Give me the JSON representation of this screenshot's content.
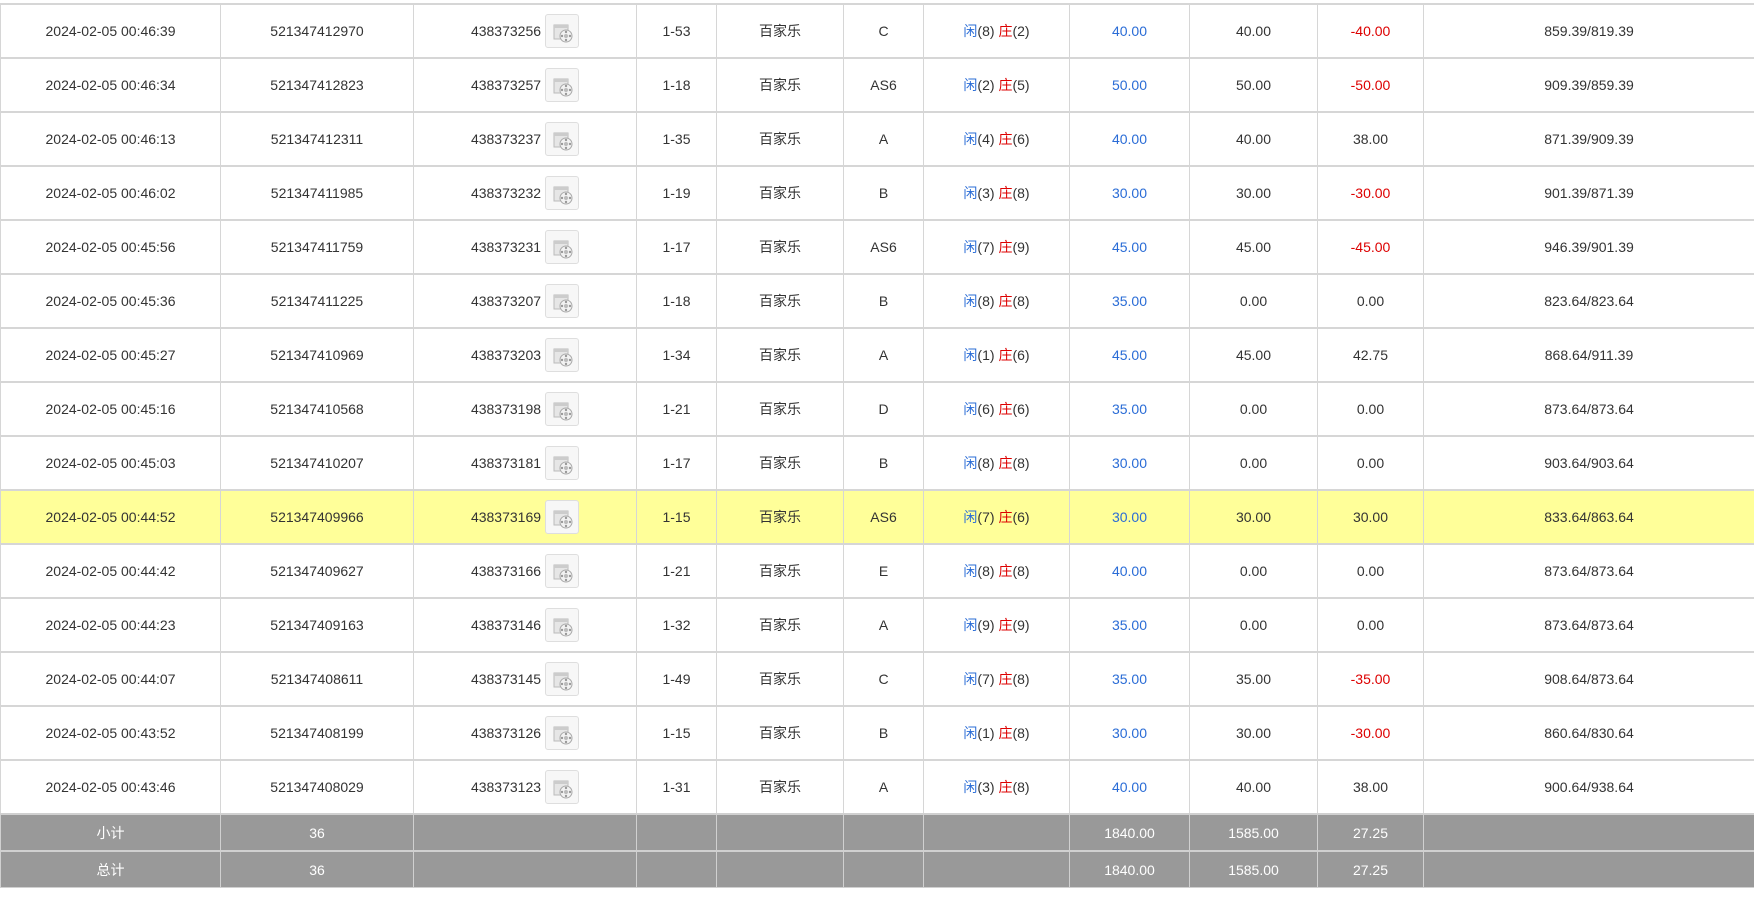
{
  "rows": [
    {
      "time": "2024-02-05 00:46:39",
      "bet_id": "521347412970",
      "round_id": "438373256",
      "table": "1-53",
      "game": "百家乐",
      "bet_on": "C",
      "player_label": "闲",
      "player_val": "(8)",
      "banker_label": "庄",
      "banker_val": "(2)",
      "bet": "40.00",
      "valid": "40.00",
      "win": "-40.00",
      "win_neg": true,
      "balance": "859.39/819.39",
      "highlight": false
    },
    {
      "time": "2024-02-05 00:46:34",
      "bet_id": "521347412823",
      "round_id": "438373257",
      "table": "1-18",
      "game": "百家乐",
      "bet_on": "AS6",
      "player_label": "闲",
      "player_val": "(2)",
      "banker_label": "庄",
      "banker_val": "(5)",
      "bet": "50.00",
      "valid": "50.00",
      "win": "-50.00",
      "win_neg": true,
      "balance": "909.39/859.39",
      "highlight": false
    },
    {
      "time": "2024-02-05 00:46:13",
      "bet_id": "521347412311",
      "round_id": "438373237",
      "table": "1-35",
      "game": "百家乐",
      "bet_on": "A",
      "player_label": "闲",
      "player_val": "(4)",
      "banker_label": "庄",
      "banker_val": "(6)",
      "bet": "40.00",
      "valid": "40.00",
      "win": "38.00",
      "win_neg": false,
      "balance": "871.39/909.39",
      "highlight": false
    },
    {
      "time": "2024-02-05 00:46:02",
      "bet_id": "521347411985",
      "round_id": "438373232",
      "table": "1-19",
      "game": "百家乐",
      "bet_on": "B",
      "player_label": "闲",
      "player_val": "(3)",
      "banker_label": "庄",
      "banker_val": "(8)",
      "bet": "30.00",
      "valid": "30.00",
      "win": "-30.00",
      "win_neg": true,
      "balance": "901.39/871.39",
      "highlight": false
    },
    {
      "time": "2024-02-05 00:45:56",
      "bet_id": "521347411759",
      "round_id": "438373231",
      "table": "1-17",
      "game": "百家乐",
      "bet_on": "AS6",
      "player_label": "闲",
      "player_val": "(7)",
      "banker_label": "庄",
      "banker_val": "(9)",
      "bet": "45.00",
      "valid": "45.00",
      "win": "-45.00",
      "win_neg": true,
      "balance": "946.39/901.39",
      "highlight": false
    },
    {
      "time": "2024-02-05 00:45:36",
      "bet_id": "521347411225",
      "round_id": "438373207",
      "table": "1-18",
      "game": "百家乐",
      "bet_on": "B",
      "player_label": "闲",
      "player_val": "(8)",
      "banker_label": "庄",
      "banker_val": "(8)",
      "bet": "35.00",
      "valid": "0.00",
      "win": "0.00",
      "win_neg": false,
      "balance": "823.64/823.64",
      "highlight": false
    },
    {
      "time": "2024-02-05 00:45:27",
      "bet_id": "521347410969",
      "round_id": "438373203",
      "table": "1-34",
      "game": "百家乐",
      "bet_on": "A",
      "player_label": "闲",
      "player_val": "(1)",
      "banker_label": "庄",
      "banker_val": "(6)",
      "bet": "45.00",
      "valid": "45.00",
      "win": "42.75",
      "win_neg": false,
      "balance": "868.64/911.39",
      "highlight": false
    },
    {
      "time": "2024-02-05 00:45:16",
      "bet_id": "521347410568",
      "round_id": "438373198",
      "table": "1-21",
      "game": "百家乐",
      "bet_on": "D",
      "player_label": "闲",
      "player_val": "(6)",
      "banker_label": "庄",
      "banker_val": "(6)",
      "bet": "35.00",
      "valid": "0.00",
      "win": "0.00",
      "win_neg": false,
      "balance": "873.64/873.64",
      "highlight": false
    },
    {
      "time": "2024-02-05 00:45:03",
      "bet_id": "521347410207",
      "round_id": "438373181",
      "table": "1-17",
      "game": "百家乐",
      "bet_on": "B",
      "player_label": "闲",
      "player_val": "(8)",
      "banker_label": "庄",
      "banker_val": "(8)",
      "bet": "30.00",
      "valid": "0.00",
      "win": "0.00",
      "win_neg": false,
      "balance": "903.64/903.64",
      "highlight": false
    },
    {
      "time": "2024-02-05 00:44:52",
      "bet_id": "521347409966",
      "round_id": "438373169",
      "table": "1-15",
      "game": "百家乐",
      "bet_on": "AS6",
      "player_label": "闲",
      "player_val": "(7)",
      "banker_label": "庄",
      "banker_val": "(6)",
      "bet": "30.00",
      "valid": "30.00",
      "win": "30.00",
      "win_neg": false,
      "balance": "833.64/863.64",
      "highlight": true
    },
    {
      "time": "2024-02-05 00:44:42",
      "bet_id": "521347409627",
      "round_id": "438373166",
      "table": "1-21",
      "game": "百家乐",
      "bet_on": "E",
      "player_label": "闲",
      "player_val": "(8)",
      "banker_label": "庄",
      "banker_val": "(8)",
      "bet": "40.00",
      "valid": "0.00",
      "win": "0.00",
      "win_neg": false,
      "balance": "873.64/873.64",
      "highlight": false
    },
    {
      "time": "2024-02-05 00:44:23",
      "bet_id": "521347409163",
      "round_id": "438373146",
      "table": "1-32",
      "game": "百家乐",
      "bet_on": "A",
      "player_label": "闲",
      "player_val": "(9)",
      "banker_label": "庄",
      "banker_val": "(9)",
      "bet": "35.00",
      "valid": "0.00",
      "win": "0.00",
      "win_neg": false,
      "balance": "873.64/873.64",
      "highlight": false
    },
    {
      "time": "2024-02-05 00:44:07",
      "bet_id": "521347408611",
      "round_id": "438373145",
      "table": "1-49",
      "game": "百家乐",
      "bet_on": "C",
      "player_label": "闲",
      "player_val": "(7)",
      "banker_label": "庄",
      "banker_val": "(8)",
      "bet": "35.00",
      "valid": "35.00",
      "win": "-35.00",
      "win_neg": true,
      "balance": "908.64/873.64",
      "highlight": false
    },
    {
      "time": "2024-02-05 00:43:52",
      "bet_id": "521347408199",
      "round_id": "438373126",
      "table": "1-15",
      "game": "百家乐",
      "bet_on": "B",
      "player_label": "闲",
      "player_val": "(1)",
      "banker_label": "庄",
      "banker_val": "(8)",
      "bet": "30.00",
      "valid": "30.00",
      "win": "-30.00",
      "win_neg": true,
      "balance": "860.64/830.64",
      "highlight": false
    },
    {
      "time": "2024-02-05 00:43:46",
      "bet_id": "521347408029",
      "round_id": "438373123",
      "table": "1-31",
      "game": "百家乐",
      "bet_on": "A",
      "player_label": "闲",
      "player_val": "(3)",
      "banker_label": "庄",
      "banker_val": "(8)",
      "bet": "40.00",
      "valid": "40.00",
      "win": "38.00",
      "win_neg": false,
      "balance": "900.64/938.64",
      "highlight": false
    }
  ],
  "subtotal": {
    "label": "小计",
    "count": "36",
    "bet": "1840.00",
    "valid": "1585.00",
    "win": "27.25"
  },
  "total": {
    "label": "总计",
    "count": "36",
    "bet": "1840.00",
    "valid": "1585.00",
    "win": "27.25"
  },
  "icons": {
    "replay": "video-replay-icon"
  },
  "colors": {
    "highlight_row": "#ffff99",
    "player_blue": "#2a6cd6",
    "banker_red": "#dd0000",
    "total_bg": "#999999"
  }
}
